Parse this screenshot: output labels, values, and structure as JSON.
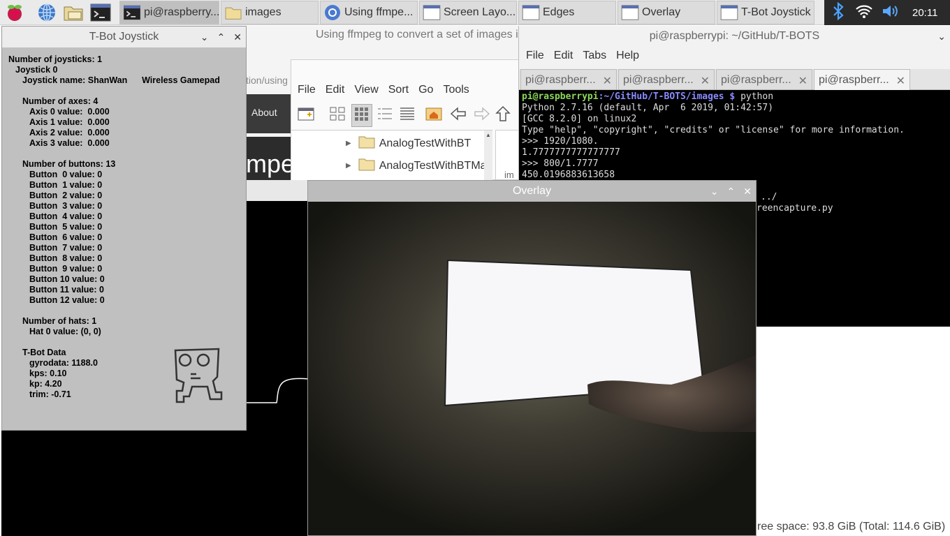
{
  "taskbar": {
    "tasks": [
      {
        "label": "pi@raspberry..."
      },
      {
        "label": "images"
      },
      {
        "label": "Using ffmpe..."
      },
      {
        "label": "Screen Layo..."
      },
      {
        "label": "Edges"
      },
      {
        "label": "Overlay"
      },
      {
        "label": "T-Bot Joystick"
      }
    ],
    "clock": "20:11"
  },
  "browser": {
    "title": "Using ffmpeg to convert a set of images i",
    "url_fragment": "tion/using",
    "nav_about": "About",
    "heading_fragment": "mpe"
  },
  "filemanager": {
    "menu": [
      "File",
      "Edit",
      "View",
      "Sort",
      "Go",
      "Tools"
    ],
    "tree_items": [
      "AnalogTestWithBT",
      "AnalogTestWithBTMa"
    ],
    "side_fragment": "im",
    "status": "ree space: 93.8 GiB (Total: 114.6 GiB)"
  },
  "terminal": {
    "title": "pi@raspberrypi: ~/GitHub/T-BOTS",
    "menu": [
      "File",
      "Edit",
      "Tabs",
      "Help"
    ],
    "tabs": [
      "pi@raspberr...",
      "pi@raspberr...",
      "pi@raspberr...",
      "pi@raspberr..."
    ],
    "prompt_user": "pi@raspberrypi",
    "prompt_path": ":~/GitHub/T-BOTS/images $",
    "command": " python",
    "lines": [
      "Python 2.7.16 (default, Apr  6 2019, 01:42:57)",
      "[GCC 8.2.0] on linux2",
      "Type \"help\", \"copyright\", \"credits\" or \"license\" for more information.",
      ">>> 1920/1080.",
      "1.7777777777777777",
      ">>> 800/1.7777",
      "450.0196883613658"
    ],
    "hidden_lines": [
      "../",
      "reencapture.py"
    ]
  },
  "joystick": {
    "title": "T-Bot Joystick",
    "num_joysticks": "Number of joysticks: 1",
    "joystick0": "Joystick 0",
    "joystick_name": "Joystick name: ShanWan      Wireless Gamepad",
    "num_axes": "Number of axes: 4",
    "axes": [
      "Axis 0 value:  0.000",
      "Axis 1 value:  0.000",
      "Axis 2 value:  0.000",
      "Axis 3 value:  0.000"
    ],
    "num_buttons": "Number of buttons: 13",
    "buttons": [
      "Button  0 value: 0",
      "Button  1 value: 0",
      "Button  2 value: 0",
      "Button  3 value: 0",
      "Button  4 value: 0",
      "Button  5 value: 0",
      "Button  6 value: 0",
      "Button  7 value: 0",
      "Button  8 value: 0",
      "Button  9 value: 0",
      "Button 10 value: 0",
      "Button 11 value: 0",
      "Button 12 value: 0"
    ],
    "num_hats": "Number of hats: 1",
    "hat": "Hat 0 value: (0, 0)",
    "tbot_data": "T-Bot Data",
    "gyrodata": "gyrodata: 1188.0",
    "kps": "kps: 0.10",
    "kp": "kp: 4.20",
    "trim": "trim: -0.71"
  },
  "overlay": {
    "title": "Overlay"
  }
}
